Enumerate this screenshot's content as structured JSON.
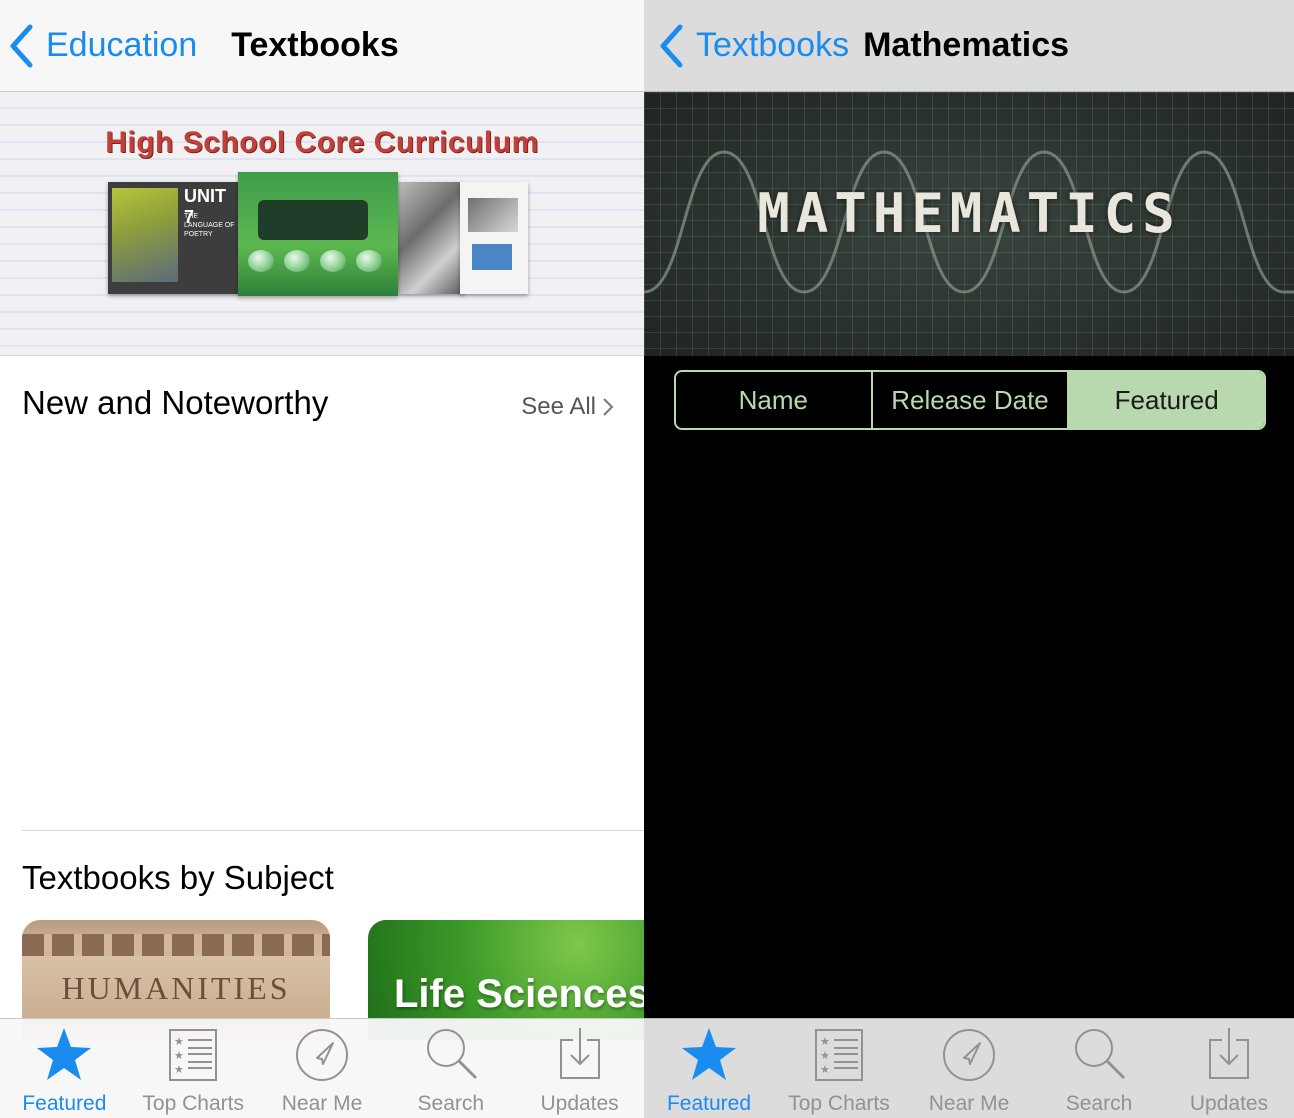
{
  "left": {
    "navbar": {
      "back_label": "Education",
      "title": "Textbooks"
    },
    "banner": {
      "title": "High School Core Curriculum",
      "book_unit": "UNIT 7",
      "book_subtitle": "THE LANGUAGE OF POETRY"
    },
    "new_noteworthy": {
      "heading": "New and Noteworthy",
      "see_all": "See All"
    },
    "by_subject": {
      "heading": "Textbooks by Subject",
      "tiles": [
        {
          "label": "HUMANITIES"
        },
        {
          "label": "Life Sciences"
        }
      ]
    },
    "tabbar": [
      {
        "label": "Featured",
        "icon": "star-icon",
        "active": true
      },
      {
        "label": "Top Charts",
        "icon": "list-icon",
        "active": false
      },
      {
        "label": "Near Me",
        "icon": "location-icon",
        "active": false
      },
      {
        "label": "Search",
        "icon": "search-icon",
        "active": false
      },
      {
        "label": "Updates",
        "icon": "download-icon",
        "active": false
      }
    ]
  },
  "right": {
    "navbar": {
      "back_label": "Textbooks",
      "title": "Mathematics"
    },
    "banner": {
      "title": "MATHEMATICS"
    },
    "segment": {
      "options": [
        "Name",
        "Release Date",
        "Featured"
      ],
      "selected": "Featured"
    },
    "tabbar": [
      {
        "label": "Featured",
        "icon": "star-icon",
        "active": true
      },
      {
        "label": "Top Charts",
        "icon": "list-icon",
        "active": false
      },
      {
        "label": "Near Me",
        "icon": "location-icon",
        "active": false
      },
      {
        "label": "Search",
        "icon": "search-icon",
        "active": false
      },
      {
        "label": "Updates",
        "icon": "download-icon",
        "active": false
      }
    ]
  },
  "colors": {
    "accent": "#1a8cf0",
    "segment_green": "#b8d9ad",
    "tab_inactive": "#929292"
  }
}
